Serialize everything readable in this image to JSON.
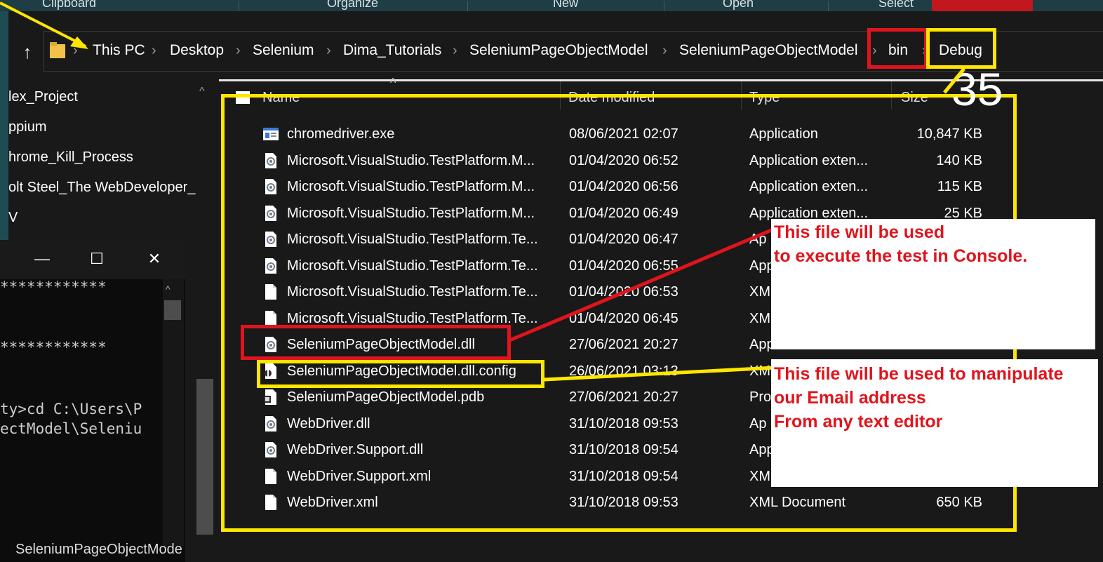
{
  "ribbon": {
    "groups": [
      "Clipboard",
      "Organize",
      "New",
      "Open",
      "Select"
    ]
  },
  "address_bar": {
    "crumbs": [
      "This PC",
      "Desktop",
      "Selenium",
      "Dima_Tutorials",
      "SeleniumPageObjectModel",
      "SeleniumPageObjectModel",
      "bin",
      "Debug"
    ]
  },
  "nav_pane": {
    "items": [
      "lex_Project",
      "ppium",
      "hrome_Kill_Process",
      "olt Steel_The WebDeveloper_",
      "V"
    ],
    "bottom_item": "SeleniumPageObjectMode"
  },
  "console": {
    "lines": [
      "************",
      "",
      "",
      "************",
      "",
      "",
      "ty>cd C:\\Users\\P",
      "ectModel\\Seleniu"
    ]
  },
  "columns": {
    "name": "Name",
    "date": "Date modified",
    "type": "Type",
    "size": "Size"
  },
  "files": [
    {
      "name": "chromedriver.exe",
      "date": "08/06/2021 02:07",
      "type": "Application",
      "size": "10,847 KB",
      "icon": "exe"
    },
    {
      "name": "Microsoft.VisualStudio.TestPlatform.M...",
      "date": "01/04/2020 06:52",
      "type": "Application exten...",
      "size": "140 KB",
      "icon": "dll"
    },
    {
      "name": "Microsoft.VisualStudio.TestPlatform.M...",
      "date": "01/04/2020 06:56",
      "type": "Application exten...",
      "size": "115 KB",
      "icon": "dll"
    },
    {
      "name": "Microsoft.VisualStudio.TestPlatform.M...",
      "date": "01/04/2020 06:49",
      "type": "Application exten...",
      "size": "25 KB",
      "icon": "dll"
    },
    {
      "name": "Microsoft.VisualStudio.TestPlatform.Te...",
      "date": "01/04/2020 06:47",
      "type": "Ap",
      "size": "",
      "icon": "dll"
    },
    {
      "name": "Microsoft.VisualStudio.TestPlatform.Te...",
      "date": "01/04/2020 06:55",
      "type": "App",
      "size": "",
      "icon": "dll"
    },
    {
      "name": "Microsoft.VisualStudio.TestPlatform.Te...",
      "date": "01/04/2020 06:53",
      "type": "XM",
      "size": "",
      "icon": "xml"
    },
    {
      "name": "Microsoft.VisualStudio.TestPlatform.Te...",
      "date": "01/04/2020 06:45",
      "type": "XM",
      "size": "",
      "icon": "xml"
    },
    {
      "name": "SeleniumPageObjectModel.dll",
      "date": "27/06/2021 20:27",
      "type": "App",
      "size": "",
      "icon": "dll"
    },
    {
      "name": "SeleniumPageObjectModel.dll.config",
      "date": "26/06/2021 03:13",
      "type": "XM",
      "size": "",
      "icon": "config"
    },
    {
      "name": "SeleniumPageObjectModel.pdb",
      "date": "27/06/2021 20:27",
      "type": "Pro",
      "size": "",
      "icon": "pdb"
    },
    {
      "name": "WebDriver.dll",
      "date": "31/10/2018 09:53",
      "type": "Ap",
      "size": "",
      "icon": "dll"
    },
    {
      "name": "WebDriver.Support.dll",
      "date": "31/10/2018 09:54",
      "type": "App",
      "size": "",
      "icon": "dll"
    },
    {
      "name": "WebDriver.Support.xml",
      "date": "31/10/2018 09:54",
      "type": "XM",
      "size": "",
      "icon": "xml"
    },
    {
      "name": "WebDriver.xml",
      "date": "31/10/2018 09:53",
      "type": "XML Document",
      "size": "650 KB",
      "icon": "xml"
    }
  ],
  "annotations": {
    "step_number": "35",
    "note_dll": [
      "This file  will be used",
      "to execute the test in Console."
    ],
    "note_config": [
      "This file will be used to manipulate",
      "our Email address",
      "From any text editor"
    ],
    "colors": {
      "yellow": "#ffe600",
      "red": "#e0141c"
    }
  }
}
